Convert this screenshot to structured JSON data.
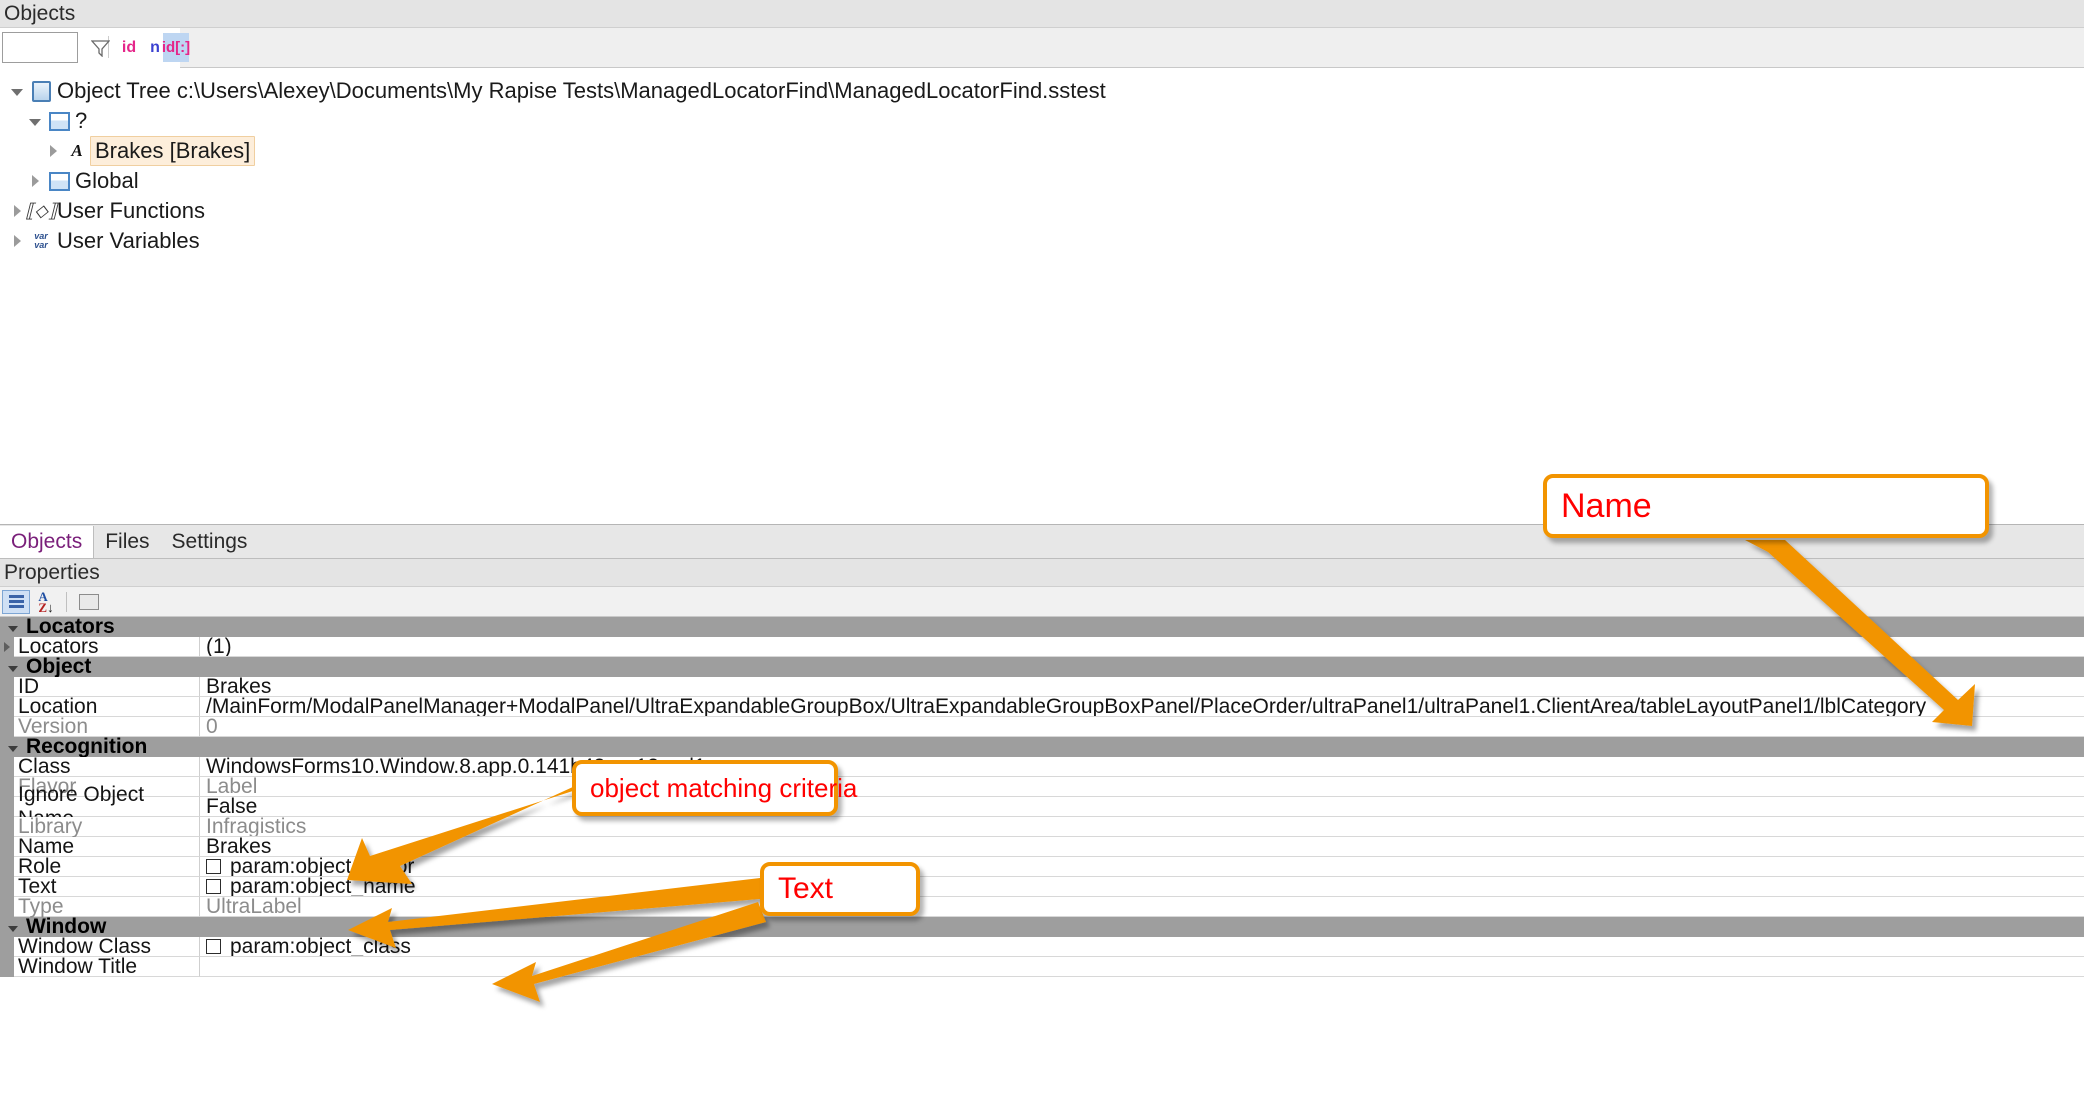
{
  "objects_panel": {
    "title": "Objects",
    "toolbar": {
      "filter_value": "",
      "filter_placeholder": "",
      "funnel_icon": "funnel-filter-icon",
      "buttons": [
        {
          "name": "id-button",
          "label": "id"
        },
        {
          "name": "n-button",
          "label": "n"
        },
        {
          "name": "idb-button",
          "label": "id[:]"
        }
      ]
    },
    "tree": [
      {
        "label": "Object Tree c:\\Users\\Alexey\\Documents\\My Rapise Tests\\ManagedLocatorFind\\ManagedLocatorFind.sstest",
        "icon": "root-document-icon",
        "indent": 0,
        "expander": "open",
        "selected": false
      },
      {
        "label": "?",
        "icon": "folder-icon",
        "indent": 1,
        "expander": "open",
        "selected": false
      },
      {
        "label": "Brakes [Brakes]",
        "icon": "label-A-icon",
        "indent": 2,
        "expander": "closed",
        "selected": true
      },
      {
        "label": "Global",
        "icon": "folder-icon",
        "indent": 1,
        "expander": "closed",
        "selected": false
      },
      {
        "label": "User Functions",
        "icon": "function-icon",
        "indent": 0,
        "expander": "closed",
        "selected": false
      },
      {
        "label": "User Variables",
        "icon": "variable-icon",
        "indent": 0,
        "expander": "closed",
        "selected": false
      }
    ]
  },
  "tabs": {
    "items": [
      {
        "label": "Objects",
        "active": true
      },
      {
        "label": "Files",
        "active": false
      },
      {
        "label": "Settings",
        "active": false
      }
    ]
  },
  "properties_panel": {
    "title": "Properties",
    "toolbar": [
      {
        "name": "categorized-view-button",
        "icon": "categorized-list-icon",
        "selected": true
      },
      {
        "name": "alphabetical-sort-button",
        "icon": "sort-az-icon",
        "selected": false
      },
      {
        "name": "property-pages-button",
        "icon": "property-pages-icon",
        "selected": false
      }
    ],
    "groups": [
      {
        "name": "Locators",
        "rows": [
          {
            "name": "Locators",
            "value": "(1)",
            "dim": false,
            "checkbox": false,
            "expandable": true
          }
        ]
      },
      {
        "name": "Object",
        "rows": [
          {
            "name": "ID",
            "value": "Brakes",
            "dim": false,
            "checkbox": false,
            "expandable": false
          },
          {
            "name": "Location",
            "value": "/MainForm/ModalPanelManager+ModalPanel/UltraExpandableGroupBox/UltraExpandableGroupBoxPanel/PlaceOrder/ultraPanel1/ultraPanel1.ClientArea/tableLayoutPanel1/lblCategory",
            "dim": false,
            "checkbox": false,
            "expandable": false
          },
          {
            "name": "Version",
            "value": "0",
            "dim": true,
            "checkbox": false,
            "expandable": false
          }
        ]
      },
      {
        "name": "Recognition",
        "rows": [
          {
            "name": "Class",
            "value": "WindowsForms10.Window.8.app.0.141b42a_r12_ad1",
            "dim": false,
            "checkbox": false,
            "expandable": false
          },
          {
            "name": "Flavor",
            "value": "Label",
            "dim": true,
            "checkbox": false,
            "expandable": false
          },
          {
            "name": "Ignore Object Name",
            "value": "False",
            "dim": false,
            "checkbox": false,
            "expandable": false
          },
          {
            "name": "Library",
            "value": "Infragistics",
            "dim": true,
            "checkbox": false,
            "expandable": false
          },
          {
            "name": "Name",
            "value": "Brakes",
            "dim": false,
            "checkbox": false,
            "expandable": false
          },
          {
            "name": "Role",
            "value": "param:object_flavor",
            "dim": false,
            "checkbox": true,
            "expandable": false
          },
          {
            "name": "Text",
            "value": "param:object_name",
            "dim": false,
            "checkbox": true,
            "expandable": false
          },
          {
            "name": "Type",
            "value": "UltraLabel",
            "dim": true,
            "checkbox": false,
            "expandable": false
          }
        ]
      },
      {
        "name": "Window",
        "rows": [
          {
            "name": "Window Class",
            "value": "param:object_class",
            "dim": false,
            "checkbox": true,
            "expandable": false
          },
          {
            "name": "Window Title",
            "value": "",
            "dim": false,
            "checkbox": false,
            "expandable": false
          }
        ]
      }
    ]
  },
  "annotations": {
    "name_callout": "Name",
    "criteria_callout": "object matching criteria",
    "text_callout": "Text",
    "accent_color": "#f29400",
    "text_color": "#ff0000"
  }
}
